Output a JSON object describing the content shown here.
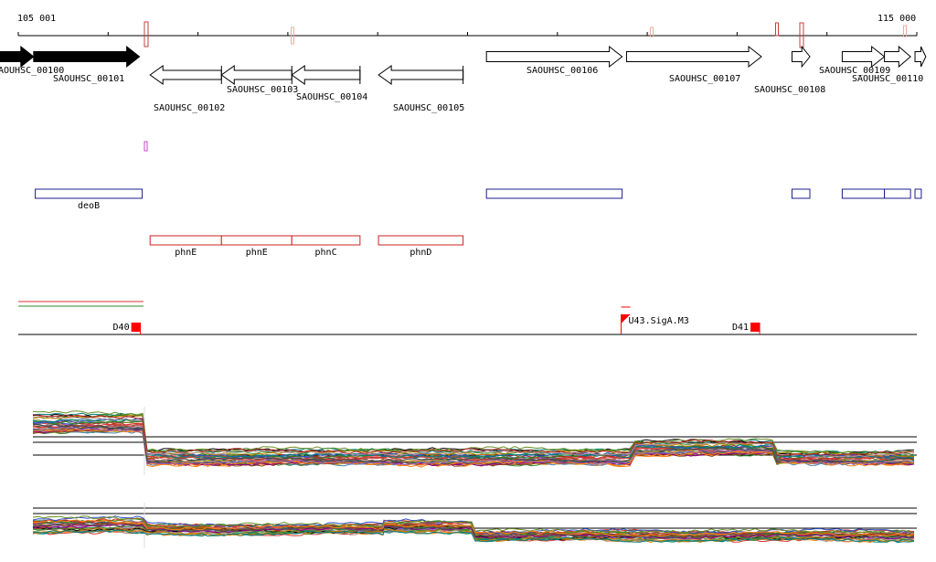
{
  "ruler": {
    "start_label": "105 001",
    "end_label": "115 000"
  },
  "genes": [
    {
      "id": "SAOUHSC_00100",
      "strand": "+",
      "filled": true,
      "start": 104620,
      "end": 105172
    },
    {
      "id": "SAOUHSC_00101",
      "strand": "+",
      "filled": true,
      "start": 105172,
      "end": 106350
    },
    {
      "id": "SAOUHSC_00102",
      "strand": "-",
      "filled": false,
      "start": 106468,
      "end": 107262
    },
    {
      "id": "SAOUHSC_00103",
      "strand": "-",
      "filled": false,
      "start": 107262,
      "end": 108045
    },
    {
      "id": "SAOUHSC_00104",
      "strand": "-",
      "filled": false,
      "start": 108045,
      "end": 108804
    },
    {
      "id": "SAOUHSC_00105",
      "strand": "-",
      "filled": false,
      "start": 109010,
      "end": 109951
    },
    {
      "id": "SAOUHSC_00106",
      "strand": "+",
      "filled": false,
      "start": 110211,
      "end": 111721
    },
    {
      "id": "SAOUHSC_00107",
      "strand": "+",
      "filled": false,
      "start": 111770,
      "end": 113271
    },
    {
      "id": "SAOUHSC_00108",
      "strand": "+",
      "filled": false,
      "start": 113611,
      "end": 113810
    },
    {
      "id": "SAOUHSC_00109",
      "strand": "+",
      "filled": false,
      "start": 114170,
      "end": 114640
    },
    {
      "id": "SAOUHSC_00110",
      "strand": "+",
      "filled": false,
      "start": 114640,
      "end": 114930
    },
    {
      "id": "SAOUHSC_00111",
      "strand": "+",
      "filled": false,
      "start": 114980,
      "end": 115100
    }
  ],
  "gene_labels": [
    {
      "text": "AOUHSC_00100",
      "gene": "SAOUHSC_00100"
    },
    {
      "text": "SAOUHSC_00101",
      "gene": "SAOUHSC_00101"
    },
    {
      "text": "SAOUHSC_00102",
      "gene": "SAOUHSC_00102"
    },
    {
      "text": "SAOUHSC_00103",
      "gene": "SAOUHSC_00103"
    },
    {
      "text": "SAOUHSC_00104",
      "gene": "SAOUHSC_00104"
    },
    {
      "text": "SAOUHSC_00105",
      "gene": "SAOUHSC_00105"
    },
    {
      "text": "SAOUHSC_00106",
      "gene": "SAOUHSC_00106"
    },
    {
      "text": "SAOUHSC_00107",
      "gene": "SAOUHSC_00107"
    },
    {
      "text": "SAOUHSC_00108",
      "gene": "SAOUHSC_00108"
    },
    {
      "text": "SAOUHSC_00109",
      "gene": "SAOUHSC_00109"
    },
    {
      "text": "SAOUHSC_00110",
      "gene": "SAOUHSC_00110"
    }
  ],
  "blue_features": [
    {
      "label": "deoB",
      "start": 105190,
      "end": 106380
    },
    {
      "label": "",
      "start": 110211,
      "end": 111721
    },
    {
      "label": "",
      "start": 113611,
      "end": 113810
    },
    {
      "label": "",
      "start": 114170,
      "end": 114640
    },
    {
      "label": "",
      "start": 114640,
      "end": 114930
    },
    {
      "label": "",
      "start": 114980,
      "end": 115050
    }
  ],
  "red_features": [
    {
      "label": "phnE",
      "start": 106468,
      "end": 107262
    },
    {
      "label": "phnE",
      "start": 107262,
      "end": 108045
    },
    {
      "label": "phnC",
      "start": 108045,
      "end": 108804
    },
    {
      "label": "phnD",
      "start": 109010,
      "end": 109951
    }
  ],
  "markers": [
    {
      "label": "D40",
      "position": 106360,
      "type": "block"
    },
    {
      "label": "U43.SigA.M3",
      "position": 111730,
      "type": "flag"
    },
    {
      "label": "D41",
      "position": 113251,
      "type": "block"
    }
  ],
  "colors": {
    "gene_filled": "#000000",
    "gene_outline": "#000000",
    "blue_feature": "#1c1c8f",
    "red_feature": "#cc2222",
    "marker": "#ff0000",
    "magenta": "#cc44cc",
    "trace_palette": [
      "#d93030",
      "#2e8b2e",
      "#3050c8",
      "#8b4513",
      "#c08000",
      "#8b008b",
      "#008080",
      "#555555",
      "#ff7f0e",
      "#6b8e23",
      "#9467bd",
      "#bc8f8f",
      "#2f4f4f",
      "#b22222",
      "#4682b4",
      "#daa520",
      "#000000",
      "#a0522d",
      "#cd5c5c",
      "#228b22"
    ]
  }
}
